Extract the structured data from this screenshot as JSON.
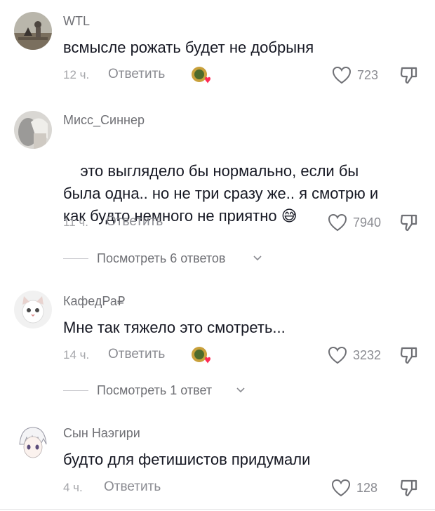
{
  "comments": [
    {
      "username": "WTL",
      "text": "всмысле рожать будет не добрыня",
      "time": "12 ч.",
      "reply_label": "Ответить",
      "likes": "723",
      "creator_liked": true
    },
    {
      "username": "Мисс_Синнер",
      "text": "это выглядело бы нормально, если бы была одна.. но не три сразу же.. я смотрю и как будто немного не приятно",
      "emoji": "😅",
      "time": "11 ч.",
      "reply_label": "Ответить",
      "likes": "7940",
      "creator_liked": false,
      "view_replies": "Посмотреть 6 ответов"
    },
    {
      "username": "КафедРа₽",
      "text": "Мне так тяжело это смотреть...",
      "time": "14 ч.",
      "reply_label": "Ответить",
      "likes": "3232",
      "creator_liked": true,
      "view_replies": "Посмотреть 1 ответ"
    },
    {
      "username": "Сын Наэгири",
      "text": "будто для фетишистов придумали",
      "time": "4 ч.",
      "reply_label": "Ответить",
      "likes": "128",
      "creator_liked": false
    }
  ],
  "icons": {
    "like": "heart-outline-icon",
    "dislike": "thumbs-down-icon",
    "creator_badge": "creator-liked-badge-icon",
    "expand": "chevron-down-icon"
  },
  "colors": {
    "text": "#161823",
    "muted": "#8a8b91",
    "time": "#a6a7ab",
    "badge_heart": "#fe2c55"
  }
}
